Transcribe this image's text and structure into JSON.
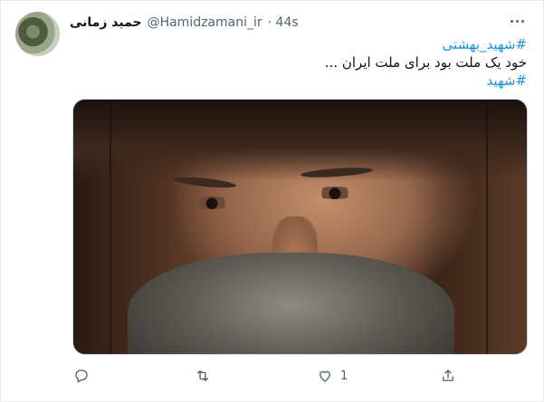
{
  "tweet": {
    "display_name": "حمید زمانی",
    "handle": "@Hamidzamani_ir",
    "time": "· 44s",
    "hashtag1": "#شهید_بهشتی",
    "body": "خود یک ملت بود برای ملت ایران ...",
    "hashtag2": "#شهید"
  },
  "actions": {
    "reply_count": "",
    "retweet_count": "",
    "like_count": "1",
    "share_count": ""
  },
  "icons": {
    "more": "more-icon",
    "reply": "reply-icon",
    "retweet": "retweet-icon",
    "like": "heart-icon",
    "share": "share-icon"
  },
  "colors": {
    "link": "#1b95e0",
    "muted": "#536471",
    "text": "#0f1419"
  }
}
